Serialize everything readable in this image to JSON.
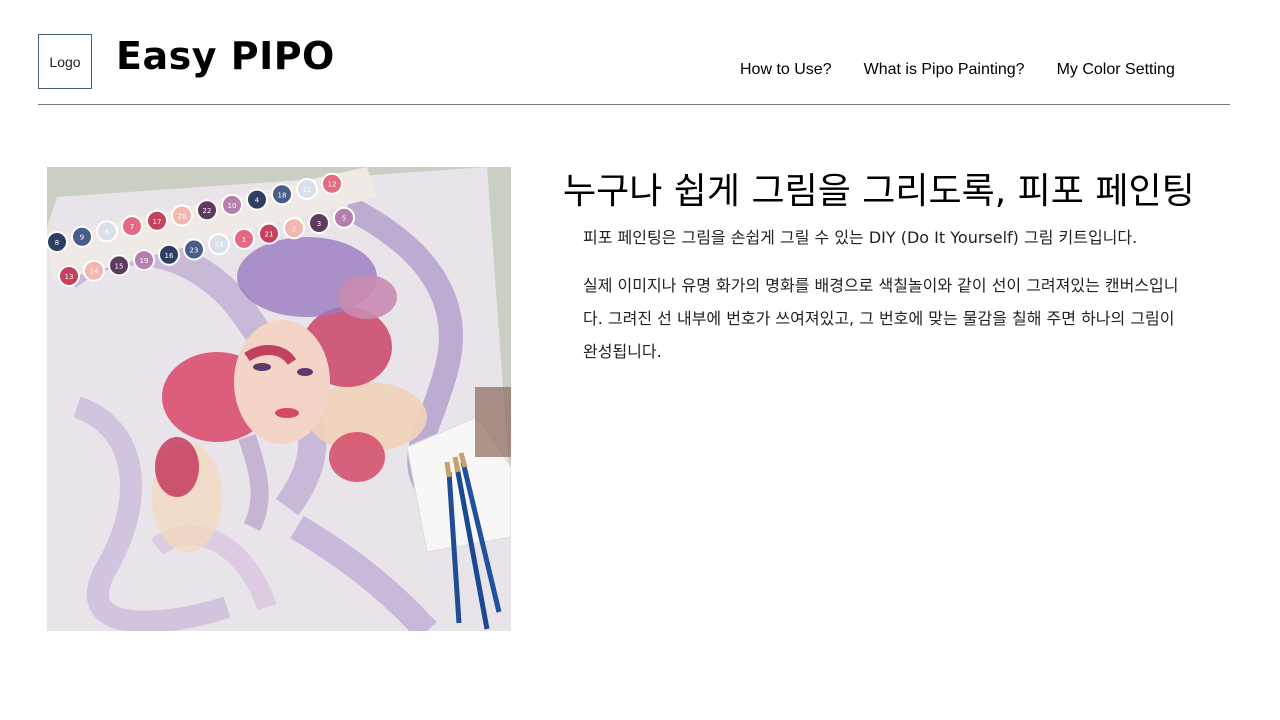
{
  "header": {
    "logo_label": "Logo",
    "brand": "Easy PIPO",
    "nav": [
      {
        "label": "How to Use?"
      },
      {
        "label": "What is Pipo Painting?"
      },
      {
        "label": "My Color Setting"
      }
    ]
  },
  "main": {
    "heading": "누구나 쉽게 그림을 그리도록, 피포 페인팅",
    "intro": "피포 페인팅은 그림을 손쉽게 그릴 수 있는 DIY (Do It Yourself) 그림 키트입니다.",
    "description": "실제 이미지나 유명 화가의 명화를 배경으로 색칠놀이와 같이 선이 그려져있는 캔버스입니다. 그려진 선 내부에 번호가 쓰여져있고, 그 번호에 맞는 물감을 칠해 주면 하나의 그림이 완성됩니다."
  },
  "image": {
    "paint_pot_numbers": [
      "8",
      "9",
      "6",
      "7",
      "17",
      "20",
      "22",
      "10",
      "4",
      "18",
      "11",
      "12",
      "13",
      "14",
      "15",
      "19",
      "16",
      "23",
      "24",
      "1",
      "21",
      "2",
      "3",
      "5"
    ]
  }
}
